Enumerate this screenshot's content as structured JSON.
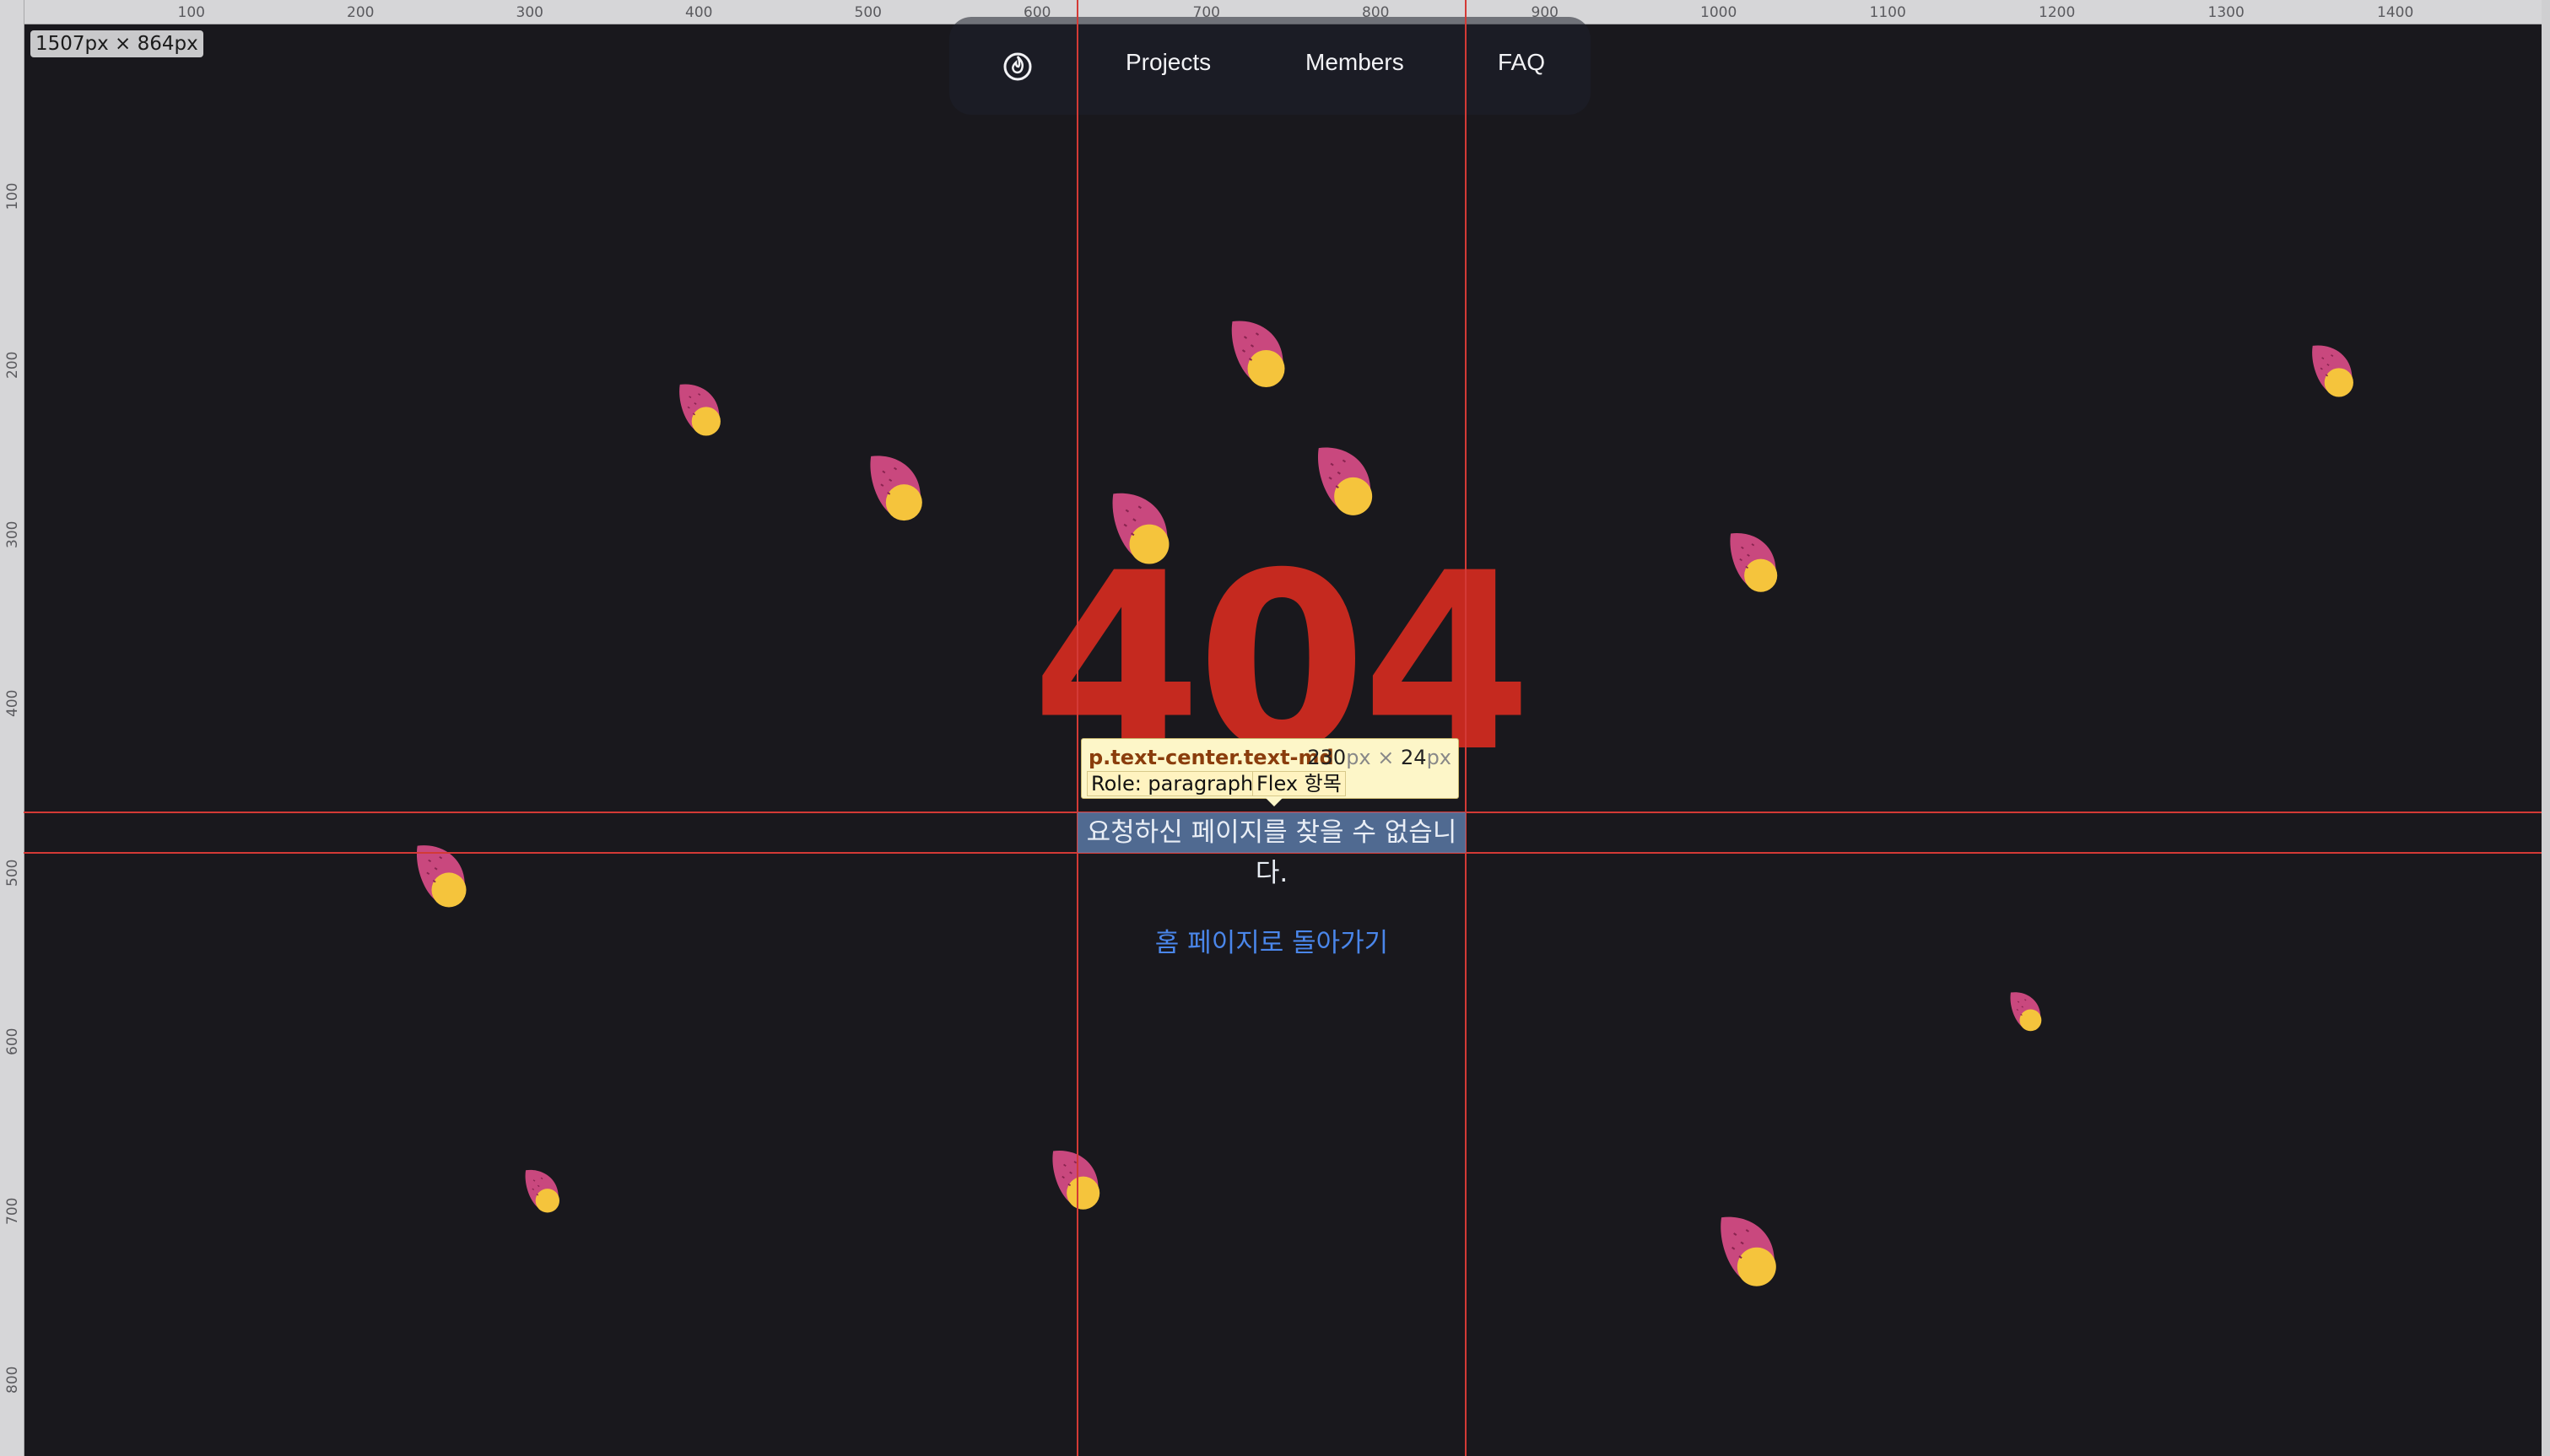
{
  "inspector": {
    "viewport_size": "1507px × 864px",
    "ruler_top_ticks": [
      "100",
      "200",
      "300",
      "400",
      "500",
      "600",
      "700",
      "800",
      "900",
      "1000",
      "1100",
      "1200",
      "1300",
      "1400"
    ],
    "ruler_left_ticks": [
      "100",
      "200",
      "300",
      "400",
      "500",
      "600",
      "700",
      "800"
    ],
    "tooltip": {
      "selector": "p.text-center.text-md",
      "width_value": "230",
      "height_value": "24",
      "unit": "px",
      "times": "×",
      "role_chip": "Role: paragraph",
      "flex_chip": "Flex 항목"
    }
  },
  "nav": {
    "logo_icon": "flame-icon",
    "links": [
      "Projects",
      "Members",
      "FAQ"
    ]
  },
  "error": {
    "code": "404",
    "message": "요청하신 페이지를 찾을 수 없습니다.",
    "home_link": "홈 페이지로 돌아가기"
  },
  "colors": {
    "background": "#19181d",
    "accent_red": "#c5291f",
    "link_blue": "#4a86ea",
    "potato_skin": "#c9487e",
    "potato_flesh": "#f5c43c"
  }
}
